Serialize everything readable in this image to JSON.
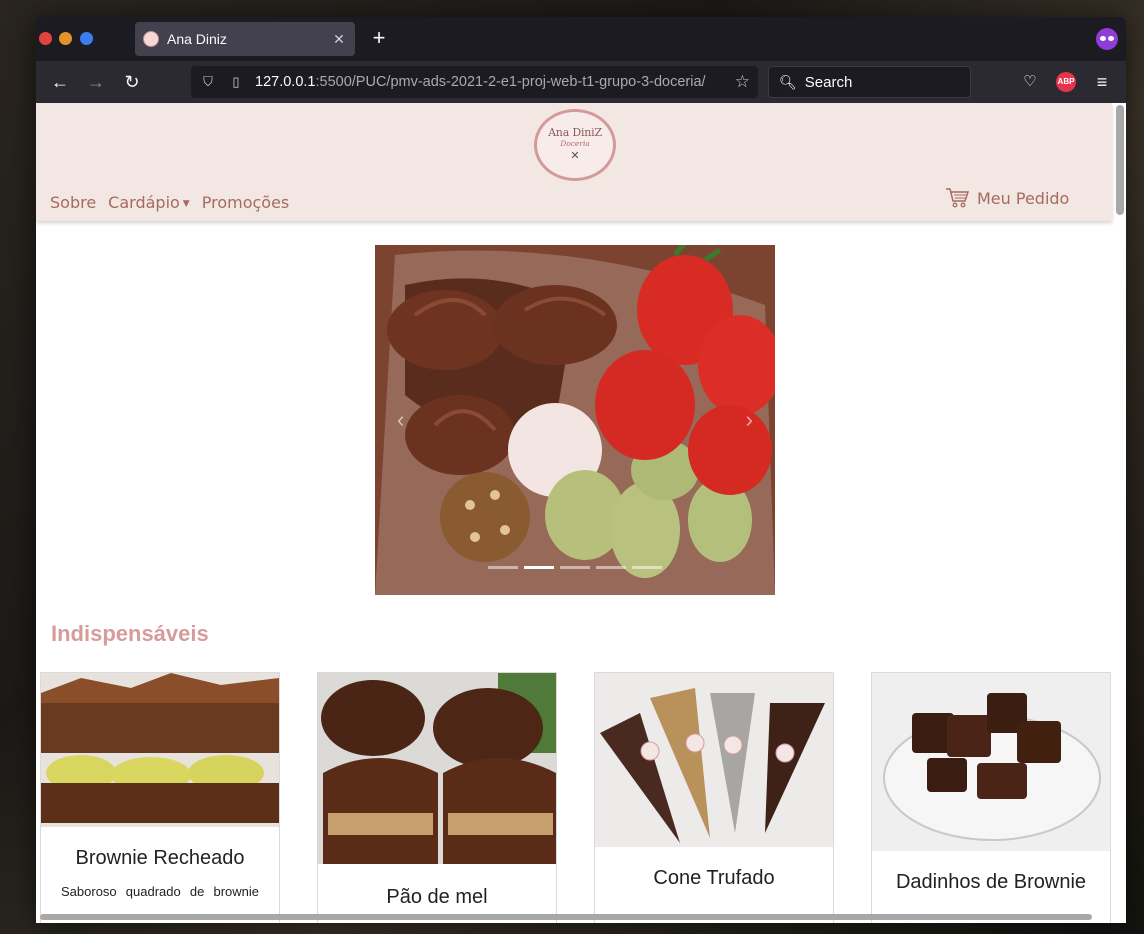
{
  "browser": {
    "tab_title": "Ana Diniz",
    "url_host": "127.0.0.1",
    "url_path": ":5500/PUC/pmv-ads-2021-2-e1-proj-web-t1-grupo-3-doceria/",
    "search_placeholder": "Search",
    "abp_label": "ABP"
  },
  "site": {
    "logo_line1": "Ana DiniZ",
    "logo_line2": "Doceria",
    "nav": {
      "sobre": "Sobre",
      "cardapio": "Cardápio",
      "promocoes": "Promoções"
    },
    "cart_label": "Meu Pedido",
    "section_title": "Indispensáveis",
    "carousel": {
      "slide_count": 5,
      "active_index": 1
    },
    "products": [
      {
        "name": "Brownie Recheado",
        "description": "Saboroso quadrado de brownie"
      },
      {
        "name": "Pão de mel",
        "description": ""
      },
      {
        "name": "Cone Trufado",
        "description": ""
      },
      {
        "name": "Dadinhos de Brownie",
        "description": ""
      }
    ]
  },
  "colors": {
    "header_bg": "#f2e7e2",
    "nav_text": "#a56b61",
    "section_title": "#d69c9c",
    "browser_chrome": "#1c1b22"
  }
}
